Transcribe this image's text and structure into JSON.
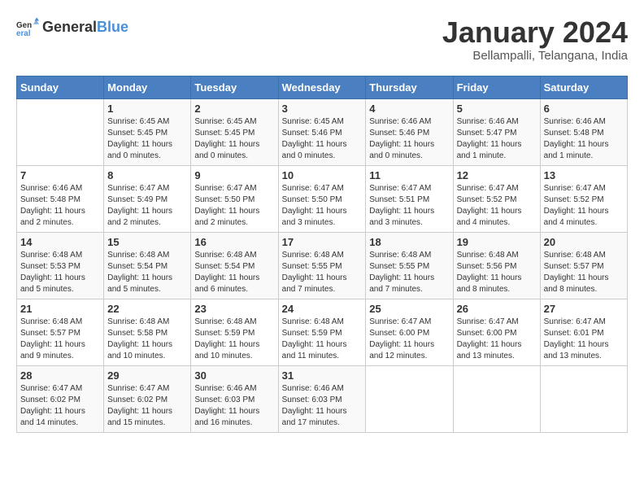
{
  "logo": {
    "general": "General",
    "blue": "Blue"
  },
  "title": {
    "month": "January 2024",
    "location": "Bellampalli, Telangana, India"
  },
  "headers": [
    "Sunday",
    "Monday",
    "Tuesday",
    "Wednesday",
    "Thursday",
    "Friday",
    "Saturday"
  ],
  "weeks": [
    [
      {
        "day": "",
        "sunrise": "",
        "sunset": "",
        "daylight": ""
      },
      {
        "day": "1",
        "sunrise": "Sunrise: 6:45 AM",
        "sunset": "Sunset: 5:45 PM",
        "daylight": "Daylight: 11 hours and 0 minutes."
      },
      {
        "day": "2",
        "sunrise": "Sunrise: 6:45 AM",
        "sunset": "Sunset: 5:45 PM",
        "daylight": "Daylight: 11 hours and 0 minutes."
      },
      {
        "day": "3",
        "sunrise": "Sunrise: 6:45 AM",
        "sunset": "Sunset: 5:46 PM",
        "daylight": "Daylight: 11 hours and 0 minutes."
      },
      {
        "day": "4",
        "sunrise": "Sunrise: 6:46 AM",
        "sunset": "Sunset: 5:46 PM",
        "daylight": "Daylight: 11 hours and 0 minutes."
      },
      {
        "day": "5",
        "sunrise": "Sunrise: 6:46 AM",
        "sunset": "Sunset: 5:47 PM",
        "daylight": "Daylight: 11 hours and 1 minute."
      },
      {
        "day": "6",
        "sunrise": "Sunrise: 6:46 AM",
        "sunset": "Sunset: 5:48 PM",
        "daylight": "Daylight: 11 hours and 1 minute."
      }
    ],
    [
      {
        "day": "7",
        "sunrise": "Sunrise: 6:46 AM",
        "sunset": "Sunset: 5:48 PM",
        "daylight": "Daylight: 11 hours and 2 minutes."
      },
      {
        "day": "8",
        "sunrise": "Sunrise: 6:47 AM",
        "sunset": "Sunset: 5:49 PM",
        "daylight": "Daylight: 11 hours and 2 minutes."
      },
      {
        "day": "9",
        "sunrise": "Sunrise: 6:47 AM",
        "sunset": "Sunset: 5:50 PM",
        "daylight": "Daylight: 11 hours and 2 minutes."
      },
      {
        "day": "10",
        "sunrise": "Sunrise: 6:47 AM",
        "sunset": "Sunset: 5:50 PM",
        "daylight": "Daylight: 11 hours and 3 minutes."
      },
      {
        "day": "11",
        "sunrise": "Sunrise: 6:47 AM",
        "sunset": "Sunset: 5:51 PM",
        "daylight": "Daylight: 11 hours and 3 minutes."
      },
      {
        "day": "12",
        "sunrise": "Sunrise: 6:47 AM",
        "sunset": "Sunset: 5:52 PM",
        "daylight": "Daylight: 11 hours and 4 minutes."
      },
      {
        "day": "13",
        "sunrise": "Sunrise: 6:47 AM",
        "sunset": "Sunset: 5:52 PM",
        "daylight": "Daylight: 11 hours and 4 minutes."
      }
    ],
    [
      {
        "day": "14",
        "sunrise": "Sunrise: 6:48 AM",
        "sunset": "Sunset: 5:53 PM",
        "daylight": "Daylight: 11 hours and 5 minutes."
      },
      {
        "day": "15",
        "sunrise": "Sunrise: 6:48 AM",
        "sunset": "Sunset: 5:54 PM",
        "daylight": "Daylight: 11 hours and 5 minutes."
      },
      {
        "day": "16",
        "sunrise": "Sunrise: 6:48 AM",
        "sunset": "Sunset: 5:54 PM",
        "daylight": "Daylight: 11 hours and 6 minutes."
      },
      {
        "day": "17",
        "sunrise": "Sunrise: 6:48 AM",
        "sunset": "Sunset: 5:55 PM",
        "daylight": "Daylight: 11 hours and 7 minutes."
      },
      {
        "day": "18",
        "sunrise": "Sunrise: 6:48 AM",
        "sunset": "Sunset: 5:55 PM",
        "daylight": "Daylight: 11 hours and 7 minutes."
      },
      {
        "day": "19",
        "sunrise": "Sunrise: 6:48 AM",
        "sunset": "Sunset: 5:56 PM",
        "daylight": "Daylight: 11 hours and 8 minutes."
      },
      {
        "day": "20",
        "sunrise": "Sunrise: 6:48 AM",
        "sunset": "Sunset: 5:57 PM",
        "daylight": "Daylight: 11 hours and 8 minutes."
      }
    ],
    [
      {
        "day": "21",
        "sunrise": "Sunrise: 6:48 AM",
        "sunset": "Sunset: 5:57 PM",
        "daylight": "Daylight: 11 hours and 9 minutes."
      },
      {
        "day": "22",
        "sunrise": "Sunrise: 6:48 AM",
        "sunset": "Sunset: 5:58 PM",
        "daylight": "Daylight: 11 hours and 10 minutes."
      },
      {
        "day": "23",
        "sunrise": "Sunrise: 6:48 AM",
        "sunset": "Sunset: 5:59 PM",
        "daylight": "Daylight: 11 hours and 10 minutes."
      },
      {
        "day": "24",
        "sunrise": "Sunrise: 6:48 AM",
        "sunset": "Sunset: 5:59 PM",
        "daylight": "Daylight: 11 hours and 11 minutes."
      },
      {
        "day": "25",
        "sunrise": "Sunrise: 6:47 AM",
        "sunset": "Sunset: 6:00 PM",
        "daylight": "Daylight: 11 hours and 12 minutes."
      },
      {
        "day": "26",
        "sunrise": "Sunrise: 6:47 AM",
        "sunset": "Sunset: 6:00 PM",
        "daylight": "Daylight: 11 hours and 13 minutes."
      },
      {
        "day": "27",
        "sunrise": "Sunrise: 6:47 AM",
        "sunset": "Sunset: 6:01 PM",
        "daylight": "Daylight: 11 hours and 13 minutes."
      }
    ],
    [
      {
        "day": "28",
        "sunrise": "Sunrise: 6:47 AM",
        "sunset": "Sunset: 6:02 PM",
        "daylight": "Daylight: 11 hours and 14 minutes."
      },
      {
        "day": "29",
        "sunrise": "Sunrise: 6:47 AM",
        "sunset": "Sunset: 6:02 PM",
        "daylight": "Daylight: 11 hours and 15 minutes."
      },
      {
        "day": "30",
        "sunrise": "Sunrise: 6:46 AM",
        "sunset": "Sunset: 6:03 PM",
        "daylight": "Daylight: 11 hours and 16 minutes."
      },
      {
        "day": "31",
        "sunrise": "Sunrise: 6:46 AM",
        "sunset": "Sunset: 6:03 PM",
        "daylight": "Daylight: 11 hours and 17 minutes."
      },
      {
        "day": "",
        "sunrise": "",
        "sunset": "",
        "daylight": ""
      },
      {
        "day": "",
        "sunrise": "",
        "sunset": "",
        "daylight": ""
      },
      {
        "day": "",
        "sunrise": "",
        "sunset": "",
        "daylight": ""
      }
    ]
  ]
}
